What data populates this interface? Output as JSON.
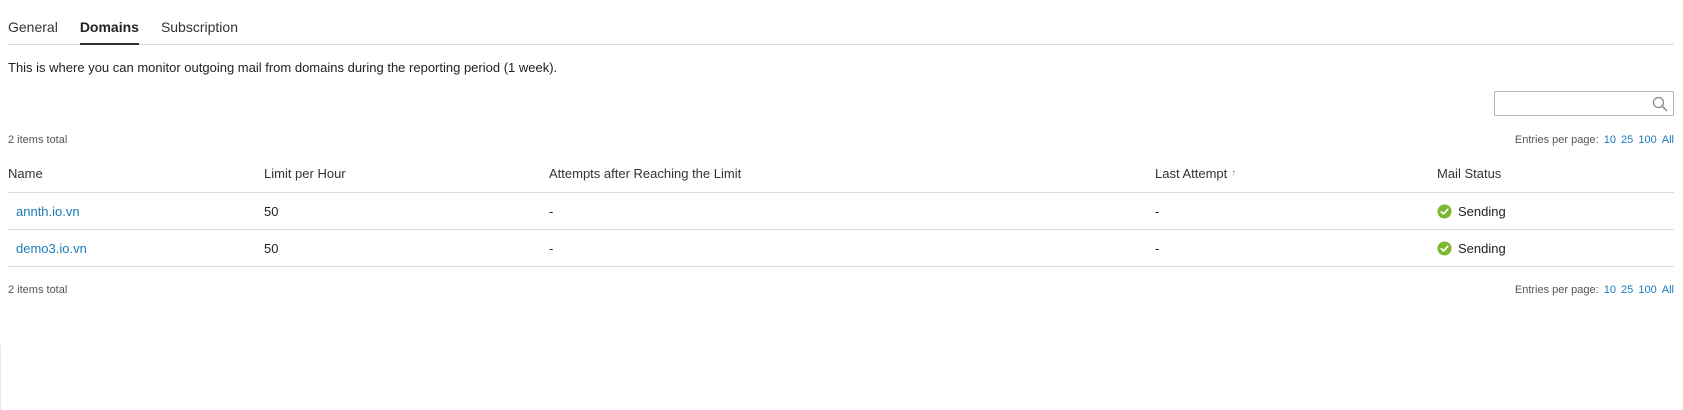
{
  "tabs": [
    {
      "label": "General"
    },
    {
      "label": "Domains"
    },
    {
      "label": "Subscription"
    }
  ],
  "active_tab": "Domains",
  "description": "This is where you can monitor outgoing mail from domains during the reporting period (1 week).",
  "search": {
    "placeholder": "",
    "value": ""
  },
  "summary": {
    "total": "2 items total",
    "entries_label": "Entries per page:",
    "page_sizes": [
      "10",
      "25",
      "100",
      "All"
    ]
  },
  "table": {
    "columns": [
      "Name",
      "Limit per Hour",
      "Attempts after Reaching the Limit",
      "Last Attempt",
      "Mail Status"
    ],
    "sort_indicator": "↑",
    "rows": [
      {
        "name": "annth.io.vn",
        "limit": "50",
        "attempts": "-",
        "last_attempt": "-",
        "status": "Sending"
      },
      {
        "name": "demo3.io.vn",
        "limit": "50",
        "attempts": "-",
        "last_attempt": "-",
        "status": "Sending"
      }
    ]
  },
  "colors": {
    "link": "#1a7bb9",
    "status_ok": "#7cb82f"
  }
}
